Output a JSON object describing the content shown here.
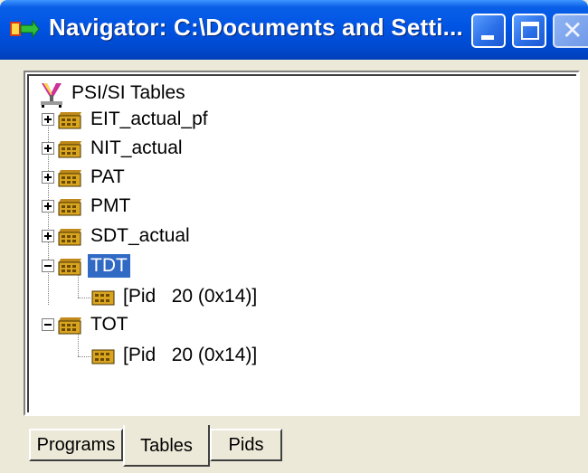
{
  "window": {
    "title": "Navigator: C:\\Documents and Setti...",
    "title_icon": "navigator-app-icon",
    "buttons": [
      "minimize",
      "maximize",
      "close"
    ]
  },
  "tree": {
    "root": {
      "label": "PSI/SI Tables",
      "icon": "antenna-icon"
    },
    "nodes": [
      {
        "label": "EIT_actual_pf",
        "expanded": false
      },
      {
        "label": "NIT_actual",
        "expanded": false
      },
      {
        "label": "PAT",
        "expanded": false
      },
      {
        "label": "PMT",
        "expanded": false
      },
      {
        "label": "SDT_actual",
        "expanded": false
      },
      {
        "label": "TDT",
        "expanded": true,
        "selected": true,
        "children": [
          {
            "label": "[Pid   20 (0x14)]"
          }
        ]
      },
      {
        "label": "TOT",
        "expanded": true,
        "children": [
          {
            "label": "[Pid   20 (0x14)]"
          }
        ]
      }
    ]
  },
  "tabs": [
    {
      "label": "Programs",
      "active": false
    },
    {
      "label": "Tables",
      "active": true
    },
    {
      "label": "Pids",
      "active": false
    }
  ],
  "colors": {
    "titlebar": "#0054e3",
    "selection": "#316ac5",
    "face": "#ece9d8"
  }
}
